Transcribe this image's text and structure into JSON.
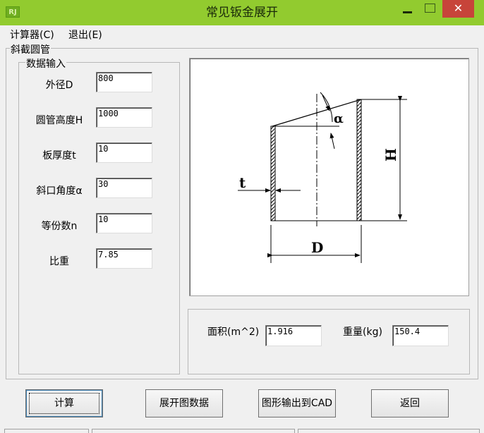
{
  "window": {
    "icon": "RJ",
    "title": "常见钣金展开",
    "close_glyph": "✕"
  },
  "menu": [
    {
      "label": "计算器(C)"
    },
    {
      "label": "退出(E)"
    }
  ],
  "outer_group": {
    "label": "斜截圆管"
  },
  "input_group": {
    "label": "数据输入",
    "fields": [
      {
        "label": "外径D",
        "value": "800"
      },
      {
        "label": "圆管高度H",
        "value": "1000"
      },
      {
        "label": "板厚度t",
        "value": "10"
      },
      {
        "label": "斜口角度α",
        "value": "30"
      },
      {
        "label": "等份数n",
        "value": "10"
      },
      {
        "label": "比重",
        "value": "7.85"
      }
    ]
  },
  "diagram": {
    "label_t": "t",
    "label_alpha": "α",
    "label_h": "H",
    "label_d": "D"
  },
  "results": {
    "area_label": "面积(m^2)",
    "area_value": "1.916",
    "weight_label": "重量(kg)",
    "weight_value": "150.4"
  },
  "buttons": {
    "calculate": "计算",
    "unfold_data": "展开图数据",
    "export_cad": "图形输出到CAD",
    "back": "返回"
  },
  "colors": {
    "titlebar": "#92cb2f",
    "close": "#c7443a"
  }
}
